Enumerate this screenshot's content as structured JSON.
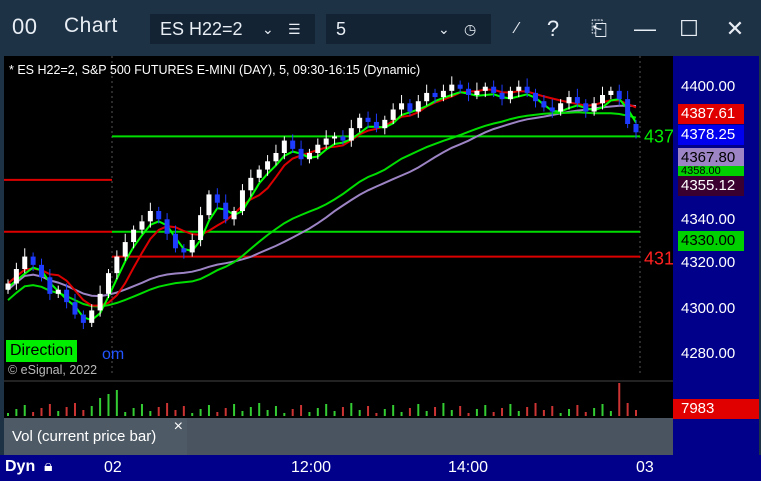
{
  "titlebar": {
    "app_icon": "00",
    "title": "Chart",
    "symbol": "ES H22=2",
    "interval": "5",
    "buttons": [
      "draw-icon",
      "help-icon",
      "template-icon",
      "minimize-icon",
      "maximize-icon",
      "close-icon"
    ]
  },
  "chart": {
    "header": "* ES H22=2, S&P 500 FUTURES E-MINI (DAY), 5, 09:30-16:15 (Dynamic)",
    "copyright": "© eSignal, 2022",
    "direction_label": "Direction",
    "direction_link_text": "om",
    "level_labels": {
      "green_upper": "437",
      "red_lower": "431"
    },
    "axis_ticks": [
      "4400.00",
      "4380.00",
      "4360.00",
      "4340.00",
      "4320.00",
      "4300.00",
      "4280.00"
    ],
    "price_tags": [
      {
        "value": "4387.61",
        "color": "#e00000",
        "text_color": "#ffffff"
      },
      {
        "value": "4378.25",
        "color": "#0000ee",
        "text_color": "#ffffff"
      },
      {
        "value": "4367.80",
        "color": "#9d84c4",
        "text_color": "#000000"
      },
      {
        "value": "4358.00",
        "color": "#00d000",
        "text_color": "#000000"
      },
      {
        "value": "4355.12",
        "color": "#3a0030",
        "text_color": "#ffffff"
      },
      {
        "value": "4330.00",
        "color": "#00d000",
        "text_color": "#000000"
      }
    ]
  },
  "volume": {
    "legend": "Vol (current price bar)",
    "close_icon": "×",
    "value": "7983"
  },
  "timebar": {
    "mode": "Dyn",
    "labels": [
      "02",
      "12:00",
      "14:00",
      "03"
    ]
  },
  "chart_data": {
    "type": "candlestick",
    "title": "* ES H22=2, S&P 500 FUTURES E-MINI (DAY), 5, 09:30-16:15 (Dynamic)",
    "ylim": [
      4270,
      4410
    ],
    "y_ticks": [
      4280,
      4300,
      4320,
      4340,
      4360,
      4380,
      4400
    ],
    "x_labels": [
      "02",
      "12:00",
      "14:00",
      "03"
    ],
    "horizontal_levels": [
      {
        "value": 4376,
        "color": "#00dd00"
      },
      {
        "value": 4330,
        "color": "#00dd00"
      },
      {
        "value": 4318,
        "color": "#dd0000"
      }
    ],
    "last_price": 4378.25,
    "close_series": [
      4305,
      4312,
      4318,
      4314,
      4308,
      4300,
      4302,
      4296,
      4290,
      4286,
      4292,
      4300,
      4310,
      4318,
      4325,
      4331,
      4335,
      4340,
      4336,
      4329,
      4322,
      4320,
      4326,
      4338,
      4348,
      4344,
      4336,
      4340,
      4350,
      4356,
      4360,
      4364,
      4368,
      4374,
      4370,
      4365,
      4368,
      4372,
      4375,
      4376,
      4374,
      4380,
      4385,
      4383,
      4380,
      4384,
      4389,
      4392,
      4388,
      4393,
      4397,
      4395,
      4398,
      4401,
      4399,
      4396,
      4398,
      4400,
      4397,
      4394,
      4398,
      4400,
      4397,
      4393,
      4390,
      4388,
      4392,
      4395,
      4392,
      4388,
      4392,
      4396,
      4398,
      4394,
      4382,
      4378
    ]
  }
}
